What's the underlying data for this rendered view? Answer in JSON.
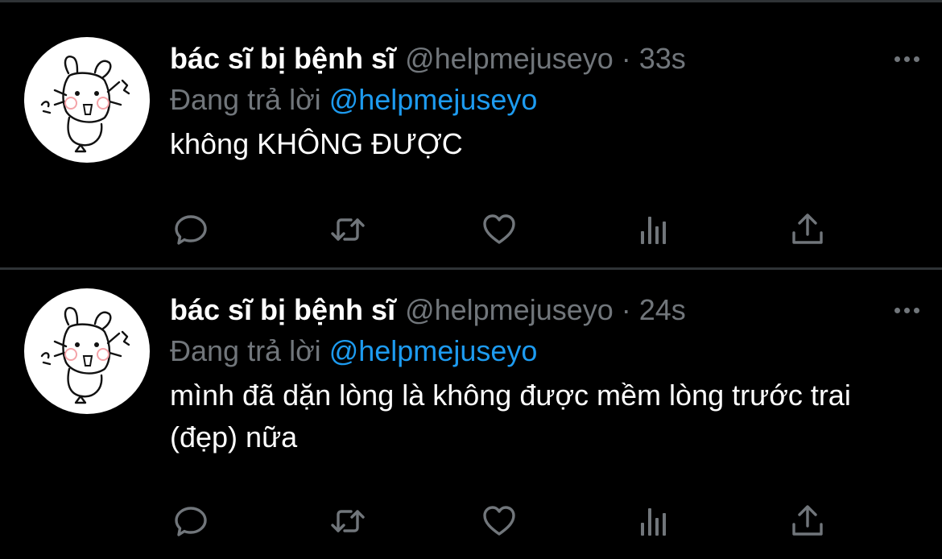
{
  "tweets": [
    {
      "author_name": "bác sĩ bị bệnh sĩ",
      "handle": "@helpmejuseyo",
      "separator": "·",
      "time": "33s",
      "replying_prefix": "Đang trả lời",
      "replying_to": "@helpmejuseyo",
      "text": "không KHÔNG ĐƯỢC"
    },
    {
      "author_name": "bác sĩ bị bệnh sĩ",
      "handle": "@helpmejuseyo",
      "separator": "·",
      "time": "24s",
      "replying_prefix": "Đang trả lời",
      "replying_to": "@helpmejuseyo",
      "text": "mình đã dặn lòng là không được mềm lòng trước trai (đẹp) nữa"
    }
  ],
  "icons": {
    "more": "more-horizontal-icon",
    "reply": "reply-bubble-icon",
    "retweet": "retweet-icon",
    "like": "heart-icon",
    "analytics": "analytics-bars-icon",
    "share": "share-upload-icon"
  },
  "colors": {
    "background": "#000000",
    "divider": "#2f3336",
    "text_primary": "#ffffff",
    "text_secondary": "#71767b",
    "accent": "#1d9bf0"
  }
}
